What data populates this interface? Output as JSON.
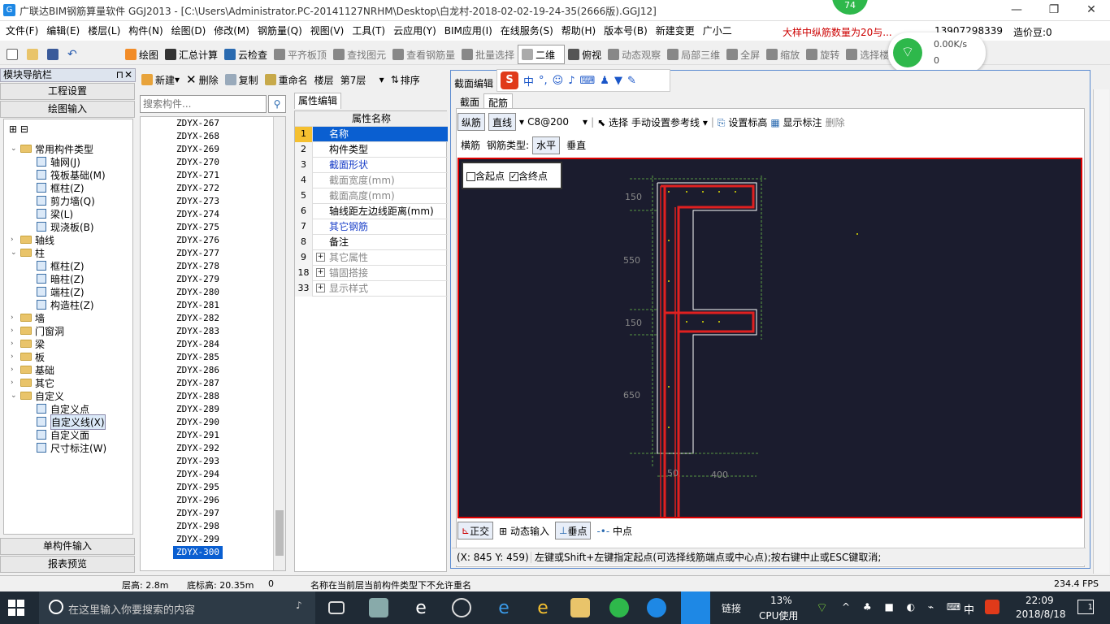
{
  "titlebar": {
    "title": "广联达BIM钢筋算量软件 GGJ2013 - [C:\\Users\\Administrator.PC-20141127NRHM\\Desktop\\白龙村-2018-02-02-19-24-35(2666版).GGJ12]",
    "badge": "74"
  },
  "menu": [
    "文件(F)",
    "编辑(E)",
    "楼层(L)",
    "构件(N)",
    "绘图(D)",
    "修改(M)",
    "钢筋量(Q)",
    "视图(V)",
    "工具(T)",
    "云应用(Y)",
    "BIM应用(I)",
    "在线服务(S)",
    "帮助(H)",
    "版本号(B)",
    "新建变更",
    "广小二"
  ],
  "menu_right": {
    "notice": "大样中纵筋数量为20与...",
    "phone": "13907298339",
    "price": "造价豆:0"
  },
  "toolbar": [
    "绘图",
    "汇总计算",
    "云检查",
    "平齐板顶",
    "查找图元",
    "查看钢筋量",
    "批量选择",
    "二维",
    "俯视",
    "动态观察",
    "局部三维",
    "全屏",
    "缩放",
    "旋转",
    "选择楼层"
  ],
  "network": {
    "speed": "0.00K/s",
    "count": "0"
  },
  "left_panel": {
    "title": "模块导航栏",
    "btn_settings": "工程设置",
    "btn_draw": "绘图输入",
    "btn_single": "单构件输入",
    "btn_report": "报表预览",
    "tree": [
      {
        "label": "常用构件类型",
        "level": 0,
        "type": "folder",
        "exp": "−"
      },
      {
        "label": "轴网(J)",
        "level": 1,
        "type": "item"
      },
      {
        "label": "筏板基础(M)",
        "level": 1,
        "type": "item"
      },
      {
        "label": "框柱(Z)",
        "level": 1,
        "type": "item"
      },
      {
        "label": "剪力墙(Q)",
        "level": 1,
        "type": "item"
      },
      {
        "label": "梁(L)",
        "level": 1,
        "type": "item"
      },
      {
        "label": "现浇板(B)",
        "level": 1,
        "type": "item"
      },
      {
        "label": "轴线",
        "level": 0,
        "type": "folder",
        "exp": "+"
      },
      {
        "label": "柱",
        "level": 0,
        "type": "folder",
        "exp": "−"
      },
      {
        "label": "框柱(Z)",
        "level": 1,
        "type": "item"
      },
      {
        "label": "暗柱(Z)",
        "level": 1,
        "type": "item"
      },
      {
        "label": "端柱(Z)",
        "level": 1,
        "type": "item"
      },
      {
        "label": "构造柱(Z)",
        "level": 1,
        "type": "item"
      },
      {
        "label": "墙",
        "level": 0,
        "type": "folder",
        "exp": "+"
      },
      {
        "label": "门窗洞",
        "level": 0,
        "type": "folder",
        "exp": "+"
      },
      {
        "label": "梁",
        "level": 0,
        "type": "folder",
        "exp": "+"
      },
      {
        "label": "板",
        "level": 0,
        "type": "folder",
        "exp": "+"
      },
      {
        "label": "基础",
        "level": 0,
        "type": "folder",
        "exp": "+"
      },
      {
        "label": "其它",
        "level": 0,
        "type": "folder",
        "exp": "+"
      },
      {
        "label": "自定义",
        "level": 0,
        "type": "folder",
        "exp": "−"
      },
      {
        "label": "自定义点",
        "level": 1,
        "type": "item"
      },
      {
        "label": "自定义线(X)",
        "level": 1,
        "type": "item"
      },
      {
        "label": "自定义面",
        "level": 1,
        "type": "item"
      },
      {
        "label": "尺寸标注(W)",
        "level": 1,
        "type": "item"
      }
    ]
  },
  "list_toolbar": {
    "new": "新建",
    "delete": "删除",
    "copy": "复制",
    "rename": "重命名",
    "floor_label": "楼层",
    "floor": "第7层",
    "sort": "排序"
  },
  "search_placeholder": "搜索构件...",
  "components": [
    "ZDYX-267",
    "ZDYX-268",
    "ZDYX-269",
    "ZDYX-270",
    "ZDYX-271",
    "ZDYX-272",
    "ZDYX-273",
    "ZDYX-274",
    "ZDYX-275",
    "ZDYX-276",
    "ZDYX-277",
    "ZDYX-278",
    "ZDYX-279",
    "ZDYX-280",
    "ZDYX-281",
    "ZDYX-282",
    "ZDYX-283",
    "ZDYX-284",
    "ZDYX-285",
    "ZDYX-286",
    "ZDYX-287",
    "ZDYX-288",
    "ZDYX-289",
    "ZDYX-290",
    "ZDYX-291",
    "ZDYX-292",
    "ZDYX-293",
    "ZDYX-294",
    "ZDYX-295",
    "ZDYX-296",
    "ZDYX-297",
    "ZDYX-298",
    "ZDYX-299",
    "ZDYX-300"
  ],
  "props": {
    "tab": "属性编辑",
    "header": "属性名称",
    "rows": [
      {
        "n": "1",
        "name": "名称",
        "style": "sel"
      },
      {
        "n": "2",
        "name": "构件类型",
        "style": "normal"
      },
      {
        "n": "3",
        "name": "截面形状",
        "style": "blue"
      },
      {
        "n": "4",
        "name": "截面宽度(mm)",
        "style": "gray"
      },
      {
        "n": "5",
        "name": "截面高度(mm)",
        "style": "gray"
      },
      {
        "n": "6",
        "name": "轴线距左边线距离(mm)",
        "style": "normal"
      },
      {
        "n": "7",
        "name": "其它钢筋",
        "style": "blue"
      },
      {
        "n": "8",
        "name": "备注",
        "style": "normal"
      },
      {
        "n": "9",
        "name": "其它属性",
        "style": "gray",
        "plus": true
      },
      {
        "n": "18",
        "name": "锚固搭接",
        "style": "gray",
        "plus": true
      },
      {
        "n": "33",
        "name": "显示样式",
        "style": "gray",
        "plus": true
      }
    ]
  },
  "dialog": {
    "title": "截面编辑",
    "tabs": [
      "截面",
      "配筋"
    ],
    "tb1": {
      "zong": "纵筋",
      "line": "直线",
      "spec": "C8@200",
      "select": "选择",
      "ref": "手动设置参考线",
      "elev": "设置标高",
      "mark": "显示标注",
      "del": "删除"
    },
    "tb2": {
      "heng": "横筋",
      "type_label": "钢筋类型:",
      "horiz": "水平",
      "vert": "垂直"
    },
    "opts": {
      "start": "含起点",
      "end": "含终点"
    },
    "dims": {
      "d150a": "150",
      "d550": "550",
      "d150b": "150",
      "d650": "650",
      "d50": "50",
      "d400": "400"
    },
    "bottom": {
      "ortho": "正交",
      "dyn": "动态输入",
      "perp": "垂点",
      "mid": "中点"
    },
    "coords": "(X: 845 Y: 459)",
    "hint": "左键或Shift+左键指定起点(可选择线筋端点或中心点);按右键中止或ESC键取消;"
  },
  "status": {
    "floor_h": "层高: 2.8m",
    "base_h": "底标高: 20.35m",
    "zero": "0",
    "msg": "名称在当前层当前构件类型下不允许重名",
    "fps": "234.4 FPS"
  },
  "taskbar": {
    "search": "在这里输入你要搜索的内容",
    "link": "链接",
    "cpu": "13%",
    "cpu_label": "CPU使用",
    "ime": "中",
    "time": "22:09",
    "date": "2018/8/18",
    "notif": "1"
  }
}
